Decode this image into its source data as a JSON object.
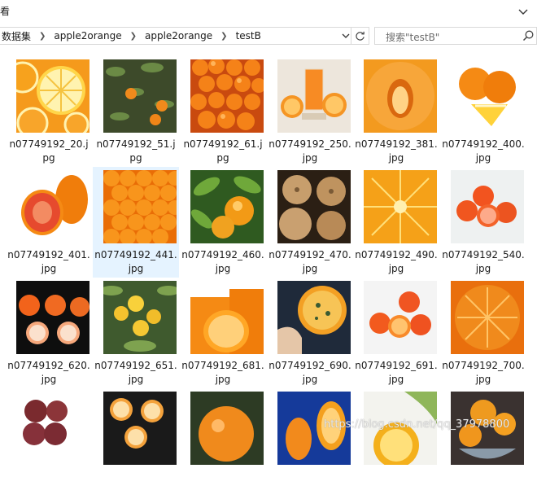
{
  "window": {
    "title": "看"
  },
  "breadcrumb": {
    "items": [
      "数据集",
      "apple2orange",
      "apple2orange",
      "testB"
    ]
  },
  "search": {
    "placeholder": "搜索\"testB\""
  },
  "colors": {
    "accent": "#f7941d",
    "selection": "#e5f3ff"
  },
  "files": [
    {
      "line1": "n07749192_20.j",
      "line2": "pg",
      "thumb": "orange-slices-icon"
    },
    {
      "line1": "n07749192_51.j",
      "line2": "pg",
      "thumb": "orange-tree-icon"
    },
    {
      "line1": "n07749192_61.j",
      "line2": "pg",
      "thumb": "orange-pile-icon"
    },
    {
      "line1": "n07749192_250.",
      "line2": "jpg",
      "thumb": "orange-juice-icon"
    },
    {
      "line1": "n07749192_381.",
      "line2": "jpg",
      "thumb": "orange-peel-icon"
    },
    {
      "line1": "n07749192_400.",
      "line2": "jpg",
      "thumb": "orange-wedge-icon"
    },
    {
      "line1": "n07749192_401.",
      "line2": "jpg",
      "thumb": "blood-orange-icon"
    },
    {
      "line1": "n07749192_441.",
      "line2": "jpg",
      "thumb": "orange-heap-icon",
      "selected": true
    },
    {
      "line1": "n07749192_460.",
      "line2": "jpg",
      "thumb": "orange-leaves-icon"
    },
    {
      "line1": "n07749192_470.",
      "line2": "jpg",
      "thumb": "brown-fruit-icon"
    },
    {
      "line1": "n07749192_490.",
      "line2": "jpg",
      "thumb": "orange-flesh-icon"
    },
    {
      "line1": "n07749192_540.",
      "line2": "jpg",
      "thumb": "orange-white-icon"
    },
    {
      "line1": "n07749192_620.",
      "line2": "jpg",
      "thumb": "orange-dark-icon"
    },
    {
      "line1": "n07749192_651.",
      "line2": "jpg",
      "thumb": "lemon-tree-icon"
    },
    {
      "line1": "n07749192_681.",
      "line2": "jpg",
      "thumb": "orange-halves-icon"
    },
    {
      "line1": "n07749192_690.",
      "line2": "jpg",
      "thumb": "orange-hand-icon"
    },
    {
      "line1": "n07749192_691.",
      "line2": "jpg",
      "thumb": "orange-trio-icon"
    },
    {
      "line1": "n07749192_700.",
      "line2": "jpg",
      "thumb": "orange-closeup-icon"
    },
    {
      "line1": "",
      "line2": "",
      "thumb": "plum-pile-icon"
    },
    {
      "line1": "",
      "line2": "",
      "thumb": "orange-cut-icon"
    },
    {
      "line1": "",
      "line2": "",
      "thumb": "single-orange-icon"
    },
    {
      "line1": "",
      "line2": "",
      "thumb": "orange-blue-icon"
    },
    {
      "line1": "",
      "line2": "",
      "thumb": "orange-leaf-icon"
    },
    {
      "line1": "",
      "line2": "",
      "thumb": "orange-bowl-icon"
    }
  ],
  "watermark": "https://blog.csdn.net/qq_37978800"
}
